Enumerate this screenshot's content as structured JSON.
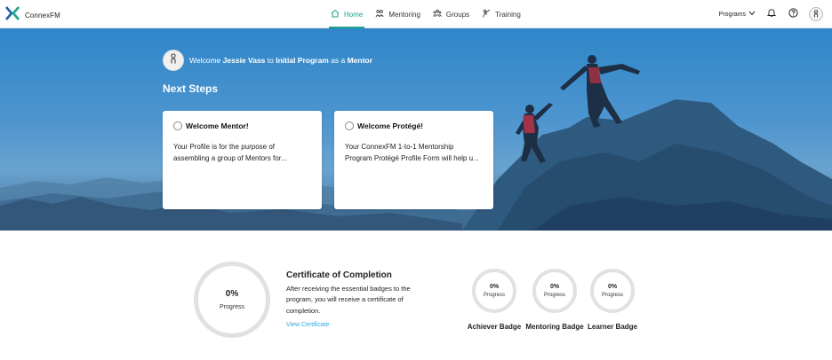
{
  "app": {
    "name": "ConnexFM"
  },
  "nav": {
    "items": [
      {
        "label": "Home",
        "icon": "home-icon",
        "active": true
      },
      {
        "label": "Mentoring",
        "icon": "mentoring-icon",
        "active": false
      },
      {
        "label": "Groups",
        "icon": "groups-icon",
        "active": false
      },
      {
        "label": "Training",
        "icon": "training-icon",
        "active": false
      }
    ],
    "programs_label": "Programs"
  },
  "colors": {
    "accent": "#1ba38c",
    "link": "#2ea6e0",
    "ring": "#e1e1e1"
  },
  "welcome": {
    "prefix": "Welcome",
    "user": "Jessie Vass",
    "to": "to",
    "program": "Initial Program",
    "as": "as a",
    "role": "Mentor"
  },
  "next_steps": {
    "heading": "Next Steps",
    "cards": [
      {
        "title": "Welcome Mentor!",
        "body": "Your Profile is for the purpose of assembling a group of Mentors for..."
      },
      {
        "title": "Welcome Protégé!",
        "body": "Your ConnexFM 1-to-1 Mentorship Program Protégé Profile Form will help u..."
      }
    ]
  },
  "certificate": {
    "progress": "0%",
    "progress_label": "Progress",
    "title": "Certificate of Completion",
    "description": "After receiving the essential badges to the program, you will receive a certificate of completion.",
    "link": "View Certificate"
  },
  "badges": [
    {
      "name": "Achiever Badge",
      "progress": "0%",
      "label": "Progress"
    },
    {
      "name": "Mentoring Badge",
      "progress": "0%",
      "label": "Progress"
    },
    {
      "name": "Learner Badge",
      "progress": "0%",
      "label": "Progress"
    }
  ]
}
